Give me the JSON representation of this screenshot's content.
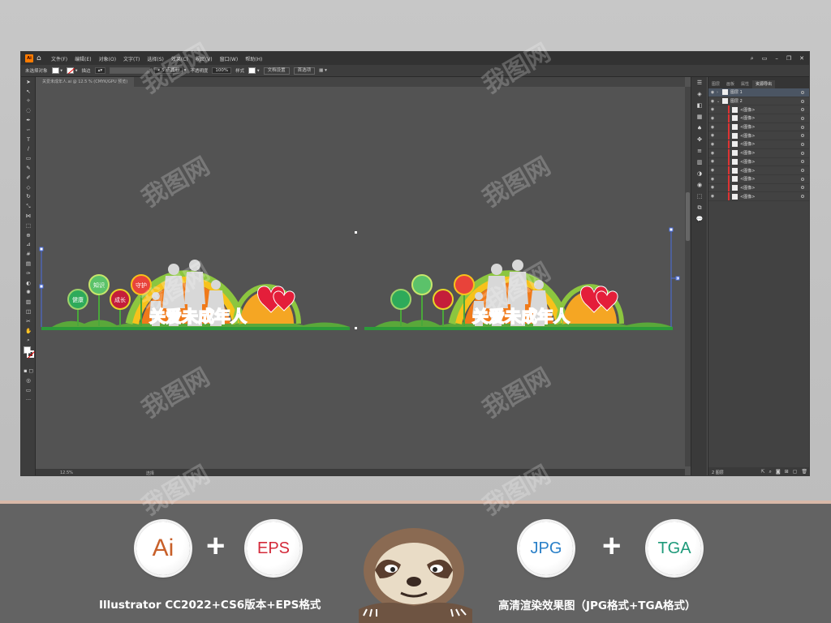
{
  "app": {
    "logo": "Ai"
  },
  "menubar": {
    "items": [
      "文件(F)",
      "编辑(E)",
      "对象(O)",
      "文字(T)",
      "选择(S)",
      "效果(C)",
      "视图(V)",
      "窗口(W)",
      "帮助(H)"
    ]
  },
  "controlbar": {
    "selection": "未选择对象",
    "stroke_label": "描边",
    "opacity_label": "不透明度",
    "opacity_value": "100%",
    "style_label": "样式",
    "doc_setup": "文档设置",
    "preferences": "首选项"
  },
  "document_tab": {
    "label": "关爱未成年人.ai @ 12.5 % (CMYK/GPU 预览)"
  },
  "statusbar": {
    "zoom": "12.5%",
    "label": "选择"
  },
  "layers_panel": {
    "tabs": [
      "图层",
      "画板",
      "属性",
      "资源导出"
    ],
    "layer1": "图层 1",
    "layer2": "图层 2",
    "image_items": [
      "<图像>",
      "<图像>",
      "<图像>",
      "<图像>",
      "<图像>",
      "<图像>",
      "<图像>",
      "<图像>",
      "<图像>",
      "<图像>",
      "<图像>"
    ],
    "footer_label": "2 图层"
  },
  "artwork": {
    "slogan_left": "关爱未成年人",
    "slogan_right": "关爱未成年人",
    "balloon_labels": [
      "知识",
      "守护",
      "成长",
      "健康"
    ]
  },
  "watermark": {
    "text": "我图网"
  },
  "bottom": {
    "badges": [
      {
        "label": "Ai",
        "color": "#c8602a"
      },
      {
        "label": "EPS",
        "color": "#d42a3a"
      },
      {
        "label": "JPG",
        "color": "#2a80c8"
      },
      {
        "label": "TGA",
        "color": "#1e9a7a"
      }
    ],
    "plus": "+",
    "caption_left": "Illustrator CC2022+CS6版本+EPS格式",
    "caption_right": "高清渲染效果图（JPG格式+TGA格式）"
  }
}
